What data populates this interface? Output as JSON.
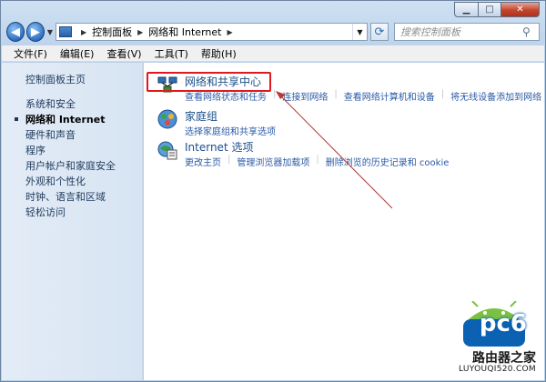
{
  "window": {
    "caption_buttons": {
      "minimize": "▁",
      "maximize": "□",
      "close": "✕"
    }
  },
  "address_bar": {
    "crumbs": [
      "控制面板",
      "网络和 Internet"
    ],
    "search_placeholder": "搜索控制面板"
  },
  "menu": [
    "文件(F)",
    "编辑(E)",
    "查看(V)",
    "工具(T)",
    "帮助(H)"
  ],
  "sidebar": {
    "home": "控制面板主页",
    "items": [
      {
        "label": "系统和安全",
        "active": false
      },
      {
        "label": "网络和 Internet",
        "active": true
      },
      {
        "label": "硬件和声音",
        "active": false
      },
      {
        "label": "程序",
        "active": false
      },
      {
        "label": "用户帐户和家庭安全",
        "active": false
      },
      {
        "label": "外观和个性化",
        "active": false
      },
      {
        "label": "时钟、语言和区域",
        "active": false
      },
      {
        "label": "轻松访问",
        "active": false
      }
    ]
  },
  "categories": [
    {
      "title": "网络和共享中心",
      "icon": "network-center-icon",
      "links": [
        "查看网络状态和任务",
        "连接到网络",
        "查看网络计算机和设备",
        "将无线设备添加到网络"
      ]
    },
    {
      "title": "家庭组",
      "icon": "homegroup-icon",
      "links": [
        "选择家庭组和共享选项"
      ]
    },
    {
      "title": "Internet 选项",
      "icon": "internet-options-icon",
      "links": [
        "更改主页",
        "管理浏览器加载项",
        "删除浏览的历史记录和 cookie"
      ]
    }
  ],
  "watermark": {
    "brand": "pc6",
    "site_cn": "路由器之家",
    "site_url": "LUYOUQI520.COM"
  },
  "colors": {
    "highlight": "#e0191e",
    "link": "#2a5aa6",
    "title": "#1b4f8a"
  }
}
